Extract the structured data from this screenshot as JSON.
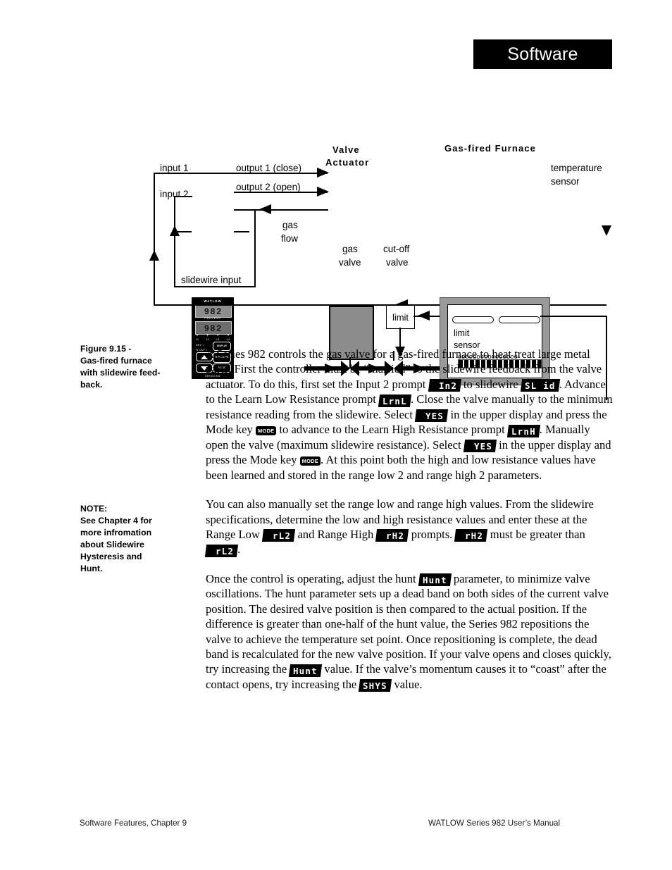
{
  "header": {
    "banner_title": "Software"
  },
  "figure": {
    "caption": "Figure 9.15 - Gas-fired furnace with slidewire feed-back.",
    "labels": {
      "input1": "input 1",
      "input2": "input 2",
      "output1": "output 1 (close)",
      "output2": "output 2 (open)",
      "slidewire_input": "slidewire input",
      "valve_actuator": "Valve Actuator",
      "valve_actuator_l1": "Valve",
      "valve_actuator_l2": "Actuator",
      "gas_flow_l1": "gas",
      "gas_flow_l2": "flow",
      "gas_valve_l1": "gas",
      "gas_valve_l2": "valve",
      "cutoff_valve_l1": "cut-off",
      "cutoff_valve_l2": "valve",
      "limit": "limit",
      "furnace_title": "Gas-fired Furnace",
      "limit_sensor_l1": "limit",
      "limit_sensor_l2": "sensor",
      "temperature_sensor_l1": "temperature",
      "temperature_sensor_l2": "sensor",
      "burner_circles": "oooooooooooooooo"
    },
    "controller": {
      "brand": "WATLOW",
      "upper_display": "982",
      "lower_display": "982",
      "process_label": "PROCESS",
      "lamps": [
        "L1",
        "L2",
        "L3",
        "L4"
      ],
      "side_labels": [
        "DEV",
        "% OUT"
      ],
      "keys": {
        "display": "DISPLAY",
        "hold": "HOLD",
        "run": "RUN",
        "mode": "MODE"
      },
      "series": "SERIES 982"
    }
  },
  "margin": {
    "figure_caption_lines": [
      "Figure 9.15 -",
      "Gas-fired furnace",
      "with slidewire feed-",
      "back."
    ],
    "note_lines": [
      "NOTE:",
      "See Chapter 4 for",
      "more infromation",
      "about Slidewire",
      "Hysteresis and",
      "Hunt."
    ]
  },
  "body": {
    "p1": {
      "t1": "A Series 982 controls the gas valve for a gas-fired furnace to heat treat large metal parts. First the controller must be “married” to the slidewire feedback from the valve actuator. To do this, first set the Input 2 prompt ",
      "seg1": "In2",
      "t2": " to slidewire ",
      "seg2": "SL id",
      "t3": ". Advance to the Learn Low Resistance prompt ",
      "seg3": "LrnL",
      "t4": ". Close the valve manually to the minimum resistance reading from the slidewire. Select ",
      "seg4": "YES",
      "t5": " in the upper display and press the Mode key ",
      "key1": "MODE",
      "t6": " to advance to the Learn High Resistance prompt ",
      "seg5": "LrnH",
      "t7": ". Manually open the valve (maximum slidewire resistance). Select ",
      "seg6": "YES",
      "t8": " in the upper display and press the Mode key ",
      "key2": "MODE",
      "t9": ". At this point both the high and low resistance values have been learned and stored in the range low 2 and range high 2 parameters."
    },
    "p2": {
      "t1": "You can also manually set the range low and range high values. From the slidewire specifications, determine the low and high resistance values and enter these at the Range Low ",
      "seg1": "rL2",
      "t2": " and Range High ",
      "seg2": "rH2",
      "t3": " prompts. ",
      "seg3": "rH2",
      "t4": " must be greater than ",
      "seg4": "rL2",
      "t5": "."
    },
    "p3": {
      "t1": "Once the control is operating, adjust the hunt ",
      "seg1": "Hunt",
      "t2": " parameter, to minimize valve oscillations. The hunt parameter sets up a dead band on both sides of the current valve position. The desired valve position is then compared to the actual position. If the difference is greater than one-half of the hunt value, the Series 982 repositions the valve to achieve the temperature set point. Once repositioning is complete, the dead band is recalculated for the new valve position. If your valve opens and closes quickly, try increasing the ",
      "seg2": "Hunt",
      "t3": " value. If the valve’s momentum causes it to “coast” after the contact opens, try increasing the ",
      "seg3": "SHYS",
      "t4": " value."
    }
  },
  "footer": {
    "left": "Software Features, Chapter 9",
    "right": "WATLOW Series 982 User’s Manual"
  }
}
